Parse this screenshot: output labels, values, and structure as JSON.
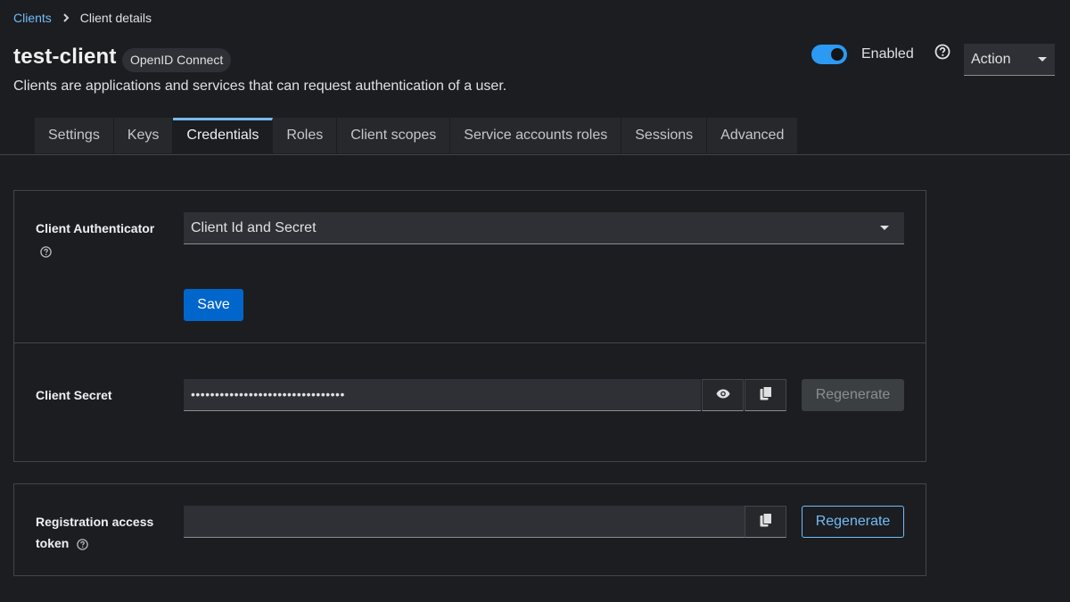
{
  "breadcrumb": {
    "parent": "Clients",
    "current": "Client details"
  },
  "header": {
    "title": "test-client",
    "badge": "OpenID Connect",
    "subtitle": "Clients are applications and services that can request authentication of a user.",
    "enabled_label": "Enabled",
    "enabled": true,
    "action_label": "Action"
  },
  "tabs": [
    {
      "label": "Settings"
    },
    {
      "label": "Keys"
    },
    {
      "label": "Credentials",
      "active": true
    },
    {
      "label": "Roles"
    },
    {
      "label": "Client scopes"
    },
    {
      "label": "Service accounts roles"
    },
    {
      "label": "Sessions"
    },
    {
      "label": "Advanced"
    }
  ],
  "credentials": {
    "authenticator_label": "Client Authenticator",
    "authenticator_value": "Client Id and Secret",
    "save_label": "Save",
    "secret_label": "Client Secret",
    "secret_value": "••••••••••••••••••••••••••••••••",
    "regenerate_secret_label": "Regenerate",
    "token_label_line1": "Registration access",
    "token_label_line2": "token",
    "token_value": "",
    "regenerate_token_label": "Regenerate"
  },
  "colors": {
    "accent": "#73bcf7",
    "primary": "#0066cc",
    "toggle_on": "#2b9af3"
  }
}
